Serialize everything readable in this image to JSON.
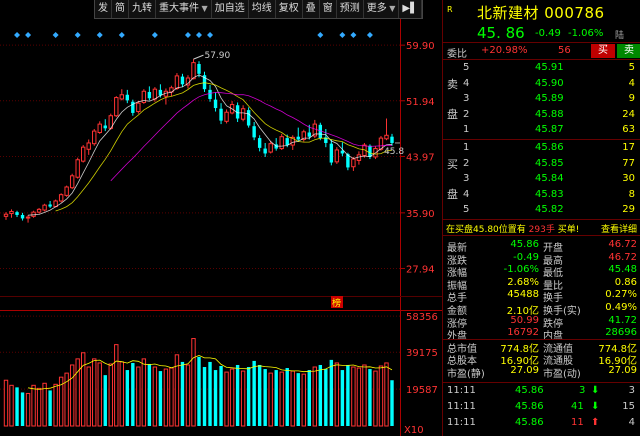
{
  "toolbar": {
    "items": [
      {
        "label": "发"
      },
      {
        "label": "简"
      },
      {
        "label": "九转"
      },
      {
        "label": "重大事件",
        "dropdown": true
      },
      {
        "label": "加自选"
      },
      {
        "label": "均线"
      },
      {
        "label": "复权"
      },
      {
        "label": "叠"
      },
      {
        "label": "窗"
      },
      {
        "label": "预测"
      },
      {
        "label": "更多",
        "dropdown": true
      },
      {
        "label": "▶▌"
      }
    ]
  },
  "chart_data": {
    "type": "candlestick",
    "price_axis_ticks": [
      "59.90",
      "51.94",
      "43.97",
      "35.90",
      "27.94"
    ],
    "price_ylim": [
      24.0,
      63.5
    ],
    "volume_axis_ticks": [
      "58356",
      "39175",
      "19587"
    ],
    "volume_unit": "X10",
    "high_annotation": "57.90",
    "last_annotation": "45.8",
    "marker_label": "榜",
    "candles": [
      [
        35.4,
        36.0,
        34.9,
        35.7
      ],
      [
        35.8,
        36.4,
        35.2,
        36.1
      ],
      [
        36.0,
        36.2,
        35.3,
        35.6
      ],
      [
        35.6,
        35.9,
        34.8,
        35.1
      ],
      [
        35.2,
        35.6,
        34.5,
        35.3
      ],
      [
        35.4,
        36.2,
        35.2,
        36.0
      ],
      [
        36.0,
        36.6,
        35.8,
        36.4
      ],
      [
        36.3,
        37.2,
        36.1,
        37.0
      ],
      [
        37.1,
        37.6,
        36.6,
        36.8
      ],
      [
        36.8,
        37.8,
        36.7,
        37.6
      ],
      [
        37.6,
        38.7,
        37.4,
        38.5
      ],
      [
        38.4,
        39.8,
        38.2,
        39.6
      ],
      [
        39.5,
        41.5,
        39.3,
        41.2
      ],
      [
        41.0,
        43.8,
        40.8,
        43.5
      ],
      [
        43.3,
        45.6,
        43.1,
        45.3
      ],
      [
        45.0,
        46.4,
        44.2,
        45.9
      ],
      [
        45.8,
        47.9,
        45.5,
        47.6
      ],
      [
        47.4,
        49.0,
        47.2,
        48.6
      ],
      [
        48.4,
        49.3,
        47.6,
        48.0
      ],
      [
        48.0,
        50.1,
        47.8,
        49.8
      ],
      [
        49.8,
        52.6,
        49.6,
        52.4
      ],
      [
        52.2,
        53.6,
        52.0,
        52.8
      ],
      [
        52.8,
        53.5,
        51.6,
        52.0
      ],
      [
        51.8,
        52.1,
        49.8,
        50.2
      ],
      [
        50.4,
        51.9,
        50.1,
        51.6
      ],
      [
        51.7,
        53.6,
        51.5,
        53.3
      ],
      [
        53.2,
        54.0,
        52.0,
        52.3
      ],
      [
        52.2,
        53.9,
        51.8,
        53.6
      ],
      [
        53.5,
        54.3,
        52.4,
        52.7
      ],
      [
        52.6,
        53.7,
        51.4,
        53.3
      ],
      [
        53.2,
        54.1,
        52.6,
        53.8
      ],
      [
        53.7,
        55.9,
        53.5,
        55.5
      ],
      [
        55.4,
        55.8,
        53.9,
        54.3
      ],
      [
        54.2,
        55.6,
        53.7,
        55.2
      ],
      [
        55.1,
        57.9,
        55.0,
        57.4
      ],
      [
        57.2,
        57.6,
        55.3,
        55.8
      ],
      [
        55.6,
        56.1,
        53.2,
        53.6
      ],
      [
        53.5,
        54.2,
        51.8,
        52.2
      ],
      [
        52.1,
        53.1,
        50.4,
        50.9
      ],
      [
        50.8,
        51.6,
        48.6,
        49.1
      ],
      [
        49.0,
        50.7,
        48.7,
        50.3
      ],
      [
        50.2,
        51.9,
        50.0,
        51.4
      ],
      [
        51.3,
        51.7,
        48.9,
        49.4
      ],
      [
        49.3,
        51.3,
        49.0,
        50.8
      ],
      [
        50.6,
        51.0,
        48.1,
        48.4
      ],
      [
        48.3,
        48.9,
        46.3,
        46.7
      ],
      [
        46.6,
        47.0,
        44.7,
        45.2
      ],
      [
        45.1,
        45.9,
        43.9,
        44.4
      ],
      [
        44.6,
        46.2,
        44.4,
        45.8
      ],
      [
        45.7,
        46.6,
        44.8,
        45.1
      ],
      [
        45.1,
        47.2,
        44.9,
        46.8
      ],
      [
        46.6,
        47.1,
        45.3,
        45.6
      ],
      [
        45.6,
        47.0,
        44.9,
        46.7
      ],
      [
        46.8,
        48.1,
        46.1,
        46.4
      ],
      [
        46.4,
        47.8,
        46.1,
        47.5
      ],
      [
        47.4,
        48.5,
        46.4,
        46.8
      ],
      [
        46.9,
        49.2,
        46.6,
        48.6
      ],
      [
        48.5,
        48.8,
        46.3,
        46.6
      ],
      [
        46.7,
        47.9,
        45.3,
        45.9
      ],
      [
        45.8,
        46.4,
        42.7,
        43.1
      ],
      [
        43.2,
        45.3,
        42.9,
        44.9
      ],
      [
        44.8,
        46.0,
        44.0,
        44.4
      ],
      [
        44.3,
        44.5,
        42.0,
        42.4
      ],
      [
        42.5,
        43.9,
        41.9,
        43.6
      ],
      [
        43.4,
        44.7,
        42.8,
        44.2
      ],
      [
        44.1,
        45.9,
        43.8,
        45.6
      ],
      [
        45.5,
        45.7,
        43.6,
        43.9
      ],
      [
        43.9,
        45.4,
        43.6,
        45.1
      ],
      [
        45.0,
        46.9,
        44.8,
        46.6
      ],
      [
        46.5,
        49.4,
        46.3,
        47.0
      ],
      [
        46.8,
        47.2,
        45.5,
        45.9
      ]
    ],
    "volumes": [
      0.45,
      0.4,
      0.38,
      0.33,
      0.32,
      0.4,
      0.37,
      0.42,
      0.35,
      0.41,
      0.48,
      0.52,
      0.6,
      0.66,
      0.72,
      0.58,
      0.66,
      0.62,
      0.5,
      0.61,
      0.8,
      0.63,
      0.55,
      0.62,
      0.58,
      0.66,
      0.61,
      0.58,
      0.54,
      0.56,
      0.57,
      0.7,
      0.63,
      0.6,
      0.86,
      0.68,
      0.58,
      0.63,
      0.55,
      0.59,
      0.53,
      0.56,
      0.6,
      0.54,
      0.58,
      0.64,
      0.6,
      0.56,
      0.52,
      0.55,
      0.53,
      0.57,
      0.54,
      0.52,
      0.51,
      0.55,
      0.58,
      0.6,
      0.56,
      0.65,
      0.62,
      0.55,
      0.6,
      0.58,
      0.57,
      0.6,
      0.56,
      0.54,
      0.59,
      0.62,
      0.45
    ],
    "volume_ylim": [
      0,
      60000
    ]
  },
  "panel": {
    "r_mark": "R",
    "title": "北新建材 000786",
    "price": "45. 86",
    "change": "-0.49",
    "change_pct": "-1.06%",
    "lu_badge": "陆",
    "webi_label": "委比",
    "webi_value": "+20.98%",
    "webi_diff": "56",
    "buy_btn": "买",
    "sell_btn": "卖",
    "sell_side_label": [
      "卖",
      "盘"
    ],
    "buy_side_label": [
      "买",
      "盘"
    ],
    "sell_orders": [
      {
        "level": "5",
        "price": "45.91",
        "vol": "5"
      },
      {
        "level": "4",
        "price": "45.90",
        "vol": "4"
      },
      {
        "level": "3",
        "price": "45.89",
        "vol": "9"
      },
      {
        "level": "2",
        "price": "45.88",
        "vol": "24"
      },
      {
        "level": "1",
        "price": "45.87",
        "vol": "63"
      }
    ],
    "buy_orders": [
      {
        "level": "1",
        "price": "45.86",
        "vol": "17"
      },
      {
        "level": "2",
        "price": "45.85",
        "vol": "77"
      },
      {
        "level": "3",
        "price": "45.84",
        "vol": "30"
      },
      {
        "level": "4",
        "price": "45.83",
        "vol": "8"
      },
      {
        "level": "5",
        "price": "45.82",
        "vol": "29"
      }
    ],
    "note_prefix": "在买盘",
    "note_price": "45.80",
    "note_mid": "位置有",
    "note_hands": "293手",
    "note_suffix": "买单!",
    "note_link": "查看详细",
    "stats": [
      {
        "l1": "最新",
        "v1": "45.86",
        "c1": "#0f0",
        "l2": "开盘",
        "v2": "46.72",
        "c2": "#f33"
      },
      {
        "l1": "涨跌",
        "v1": "-0.49",
        "c1": "#0f0",
        "l2": "最高",
        "v2": "46.72",
        "c2": "#f33"
      },
      {
        "l1": "涨幅",
        "v1": "-1.06%",
        "c1": "#0f0",
        "l2": "最低",
        "v2": "45.48",
        "c2": "#0f0"
      },
      {
        "l1": "振幅",
        "v1": "2.68%",
        "c1": "#ff0",
        "l2": "量比",
        "v2": "0.86",
        "c2": "#ff0"
      },
      {
        "l1": "总手",
        "v1": "45488",
        "c1": "#ff0",
        "l2": "换手",
        "v2": "0.27%",
        "c2": "#ff0"
      },
      {
        "l1": "金额",
        "v1": "2.10亿",
        "c1": "#ff0",
        "l2": "换手(实)",
        "v2": "0.49%",
        "c2": "#ff0"
      },
      {
        "l1": "涨停",
        "v1": "50.99",
        "c1": "#f33",
        "l2": "跌停",
        "v2": "41.72",
        "c2": "#0f0"
      },
      {
        "l1": "外盘",
        "v1": "16792",
        "c1": "#f33",
        "l2": "内盘",
        "v2": "28696",
        "c2": "#0f0"
      },
      {
        "l1": "总市值",
        "v1": "774.8亿",
        "c1": "#ff0",
        "l2": "流通值",
        "v2": "774.8亿",
        "c2": "#ff0"
      },
      {
        "l1": "总股本",
        "v1": "16.90亿",
        "c1": "#ff0",
        "l2": "流通股",
        "v2": "16.90亿",
        "c2": "#ff0"
      },
      {
        "l1": "市盈(静)",
        "v1": "27.09",
        "c1": "#ff0",
        "l2": "市盈(动)",
        "v2": "27.09",
        "c2": "#ff0"
      }
    ],
    "trades": [
      {
        "time": "11:11",
        "price": "45.86",
        "vol": "3",
        "dir": "down",
        "count": "3"
      },
      {
        "time": "11:11",
        "price": "45.86",
        "vol": "41",
        "dir": "down",
        "count": "15"
      },
      {
        "time": "11:11",
        "price": "45.86",
        "vol": "11",
        "dir": "up",
        "count": "4"
      }
    ],
    "colors": {
      "up": "#ff3333",
      "down": "#00ff00",
      "accent": "#ffff00",
      "cyan": "#00ffff",
      "grid": "#660000",
      "btn_buy": "#c00000",
      "btn_sell": "#008800"
    }
  }
}
